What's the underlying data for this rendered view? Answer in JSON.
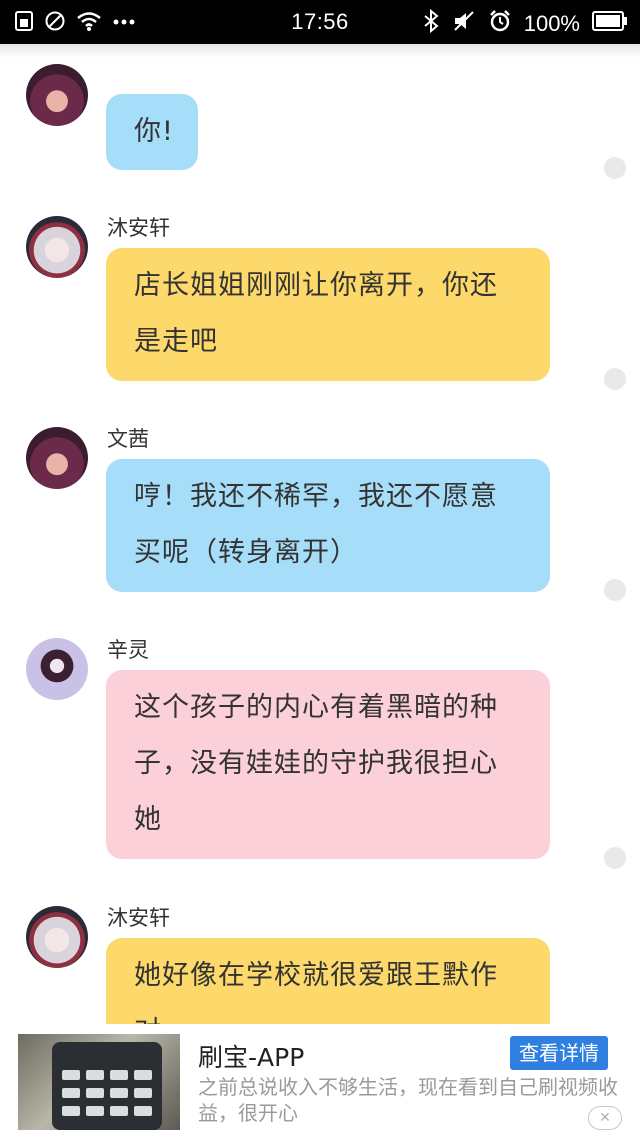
{
  "status_bar": {
    "time": "17:56",
    "battery": "100%",
    "left_icons": [
      "sim-icon",
      "no-signal-icon",
      "wifi-icon",
      "more-dots-icon"
    ],
    "right_icons": [
      "bluetooth-icon",
      "mute-icon",
      "alarm-icon",
      "battery-icon"
    ]
  },
  "messages": [
    {
      "sender": "",
      "text": "你!",
      "color": "#a6ddf8"
    },
    {
      "sender": "沐安轩",
      "text": "店长姐姐刚刚让你离开，你还是走吧",
      "color": "#fcd96a"
    },
    {
      "sender": "文茜",
      "text": "哼！我还不稀罕，我还不愿意买呢（转身离开）",
      "color": "#a6ddf8"
    },
    {
      "sender": "辛灵",
      "text": "这个孩子的内心有着黑暗的种子，没有娃娃的守护我很担心她",
      "color": "#fbd0d9"
    },
    {
      "sender": "沐安轩",
      "text": "她好像在学校就很爱跟王默作对",
      "color": "#fcd96a"
    }
  ],
  "ad": {
    "title": "刷宝-APP",
    "button": "查看详情",
    "description": "之前总说收入不够生活，现在看到自己刷视频收益，很开心",
    "close": "✕"
  }
}
